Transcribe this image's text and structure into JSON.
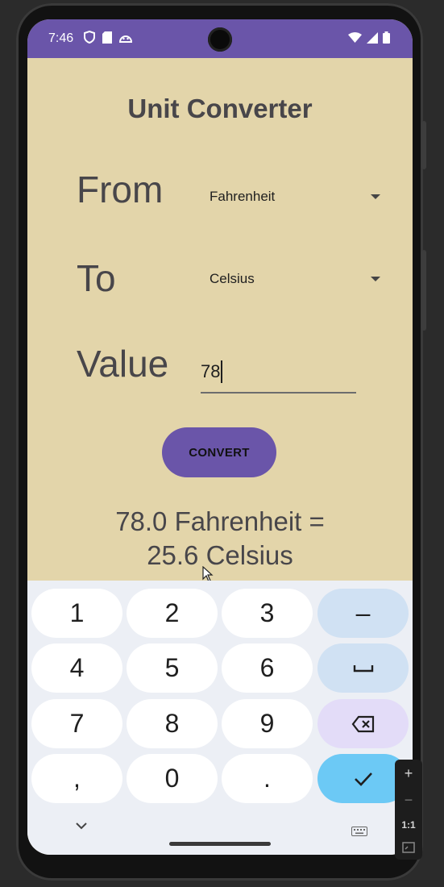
{
  "status_bar": {
    "time": "7:46",
    "left_icons": [
      "shield-icon",
      "sd-card-icon",
      "android-icon"
    ],
    "right_icons": [
      "wifi-icon",
      "signal-icon",
      "battery-icon"
    ]
  },
  "app": {
    "title": "Unit Converter",
    "from_label": "From",
    "from_value": "Fahrenheit",
    "to_label": "To",
    "to_value": "Celsius",
    "value_label": "Value",
    "value_input": "78",
    "convert_label": "CONVERT",
    "result_line1": "78.0 Fahrenheit =",
    "result_line2": "25.6 Celsius"
  },
  "keyboard": {
    "rows": [
      [
        "1",
        "2",
        "3",
        "–"
      ],
      [
        "4",
        "5",
        "6",
        "␣"
      ],
      [
        "7",
        "8",
        "9",
        "⌫"
      ],
      [
        ",",
        "0",
        ".",
        "✓"
      ]
    ],
    "hide_keyboard_icon": "chevron-down-icon",
    "switch_keyboard_icon": "keyboard-icon"
  },
  "emulator_zoom": {
    "zoom_in": "+",
    "zoom_out": "−",
    "actual_size": "1:1"
  },
  "colors": {
    "background": "#e3d5aa",
    "accent": "#6a55a9",
    "done_key": "#6cc9f5"
  }
}
